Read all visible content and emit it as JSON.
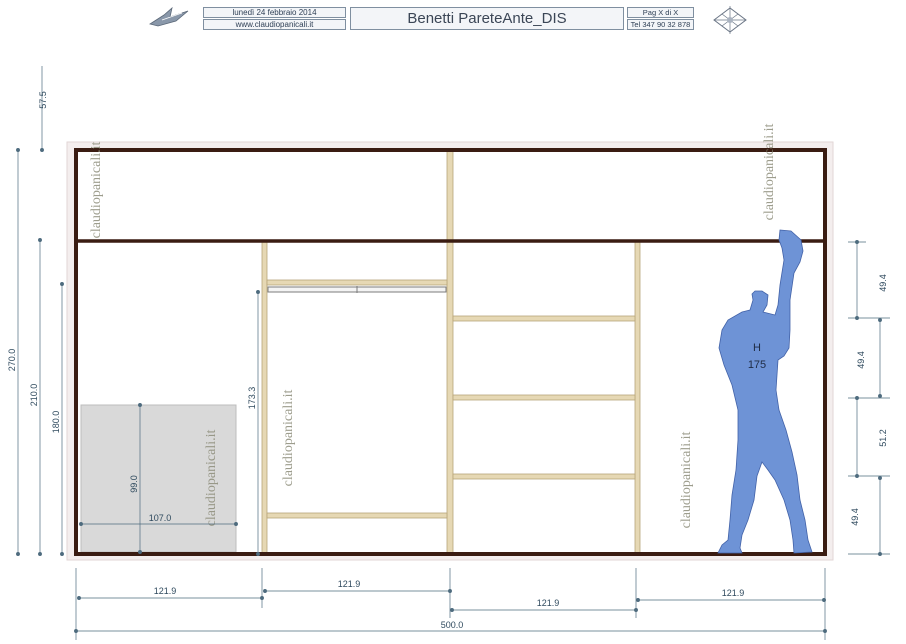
{
  "header": {
    "date": "lunedì 24 febbraio 2014",
    "website": "www.claudiopanicali.it",
    "title": "Benetti PareteAnte_DIS",
    "page": "Pag X di X",
    "tel": "Tel 347 90 32 878",
    "logo_icon": "bird-logo-icon",
    "compass_icon": "compass-rose-icon"
  },
  "drawing": {
    "watermark": "claudiopanicali.it",
    "figure_label": "H",
    "figure_height": "175",
    "colors": {
      "frame": "#3a1c12",
      "shelf": "#e6d8b4",
      "dimension": "#4e6b7e",
      "figure": "#6e93d6",
      "box": "#d9d9d9"
    },
    "dimensions": {
      "left_total": "270.0",
      "left_top": "57.5",
      "left_mid": "210.0",
      "left_inner": "180.0",
      "box_height": "99.0",
      "box_width": "107.0",
      "hang_height": "173.3",
      "right_1": "49.4",
      "right_2": "49.4",
      "right_3": "51.2",
      "right_4": "49.4",
      "bottom_1": "121.9",
      "bottom_2": "121.9",
      "bottom_3": "121.9",
      "bottom_4": "121.9",
      "bottom_total": "500.0"
    }
  }
}
